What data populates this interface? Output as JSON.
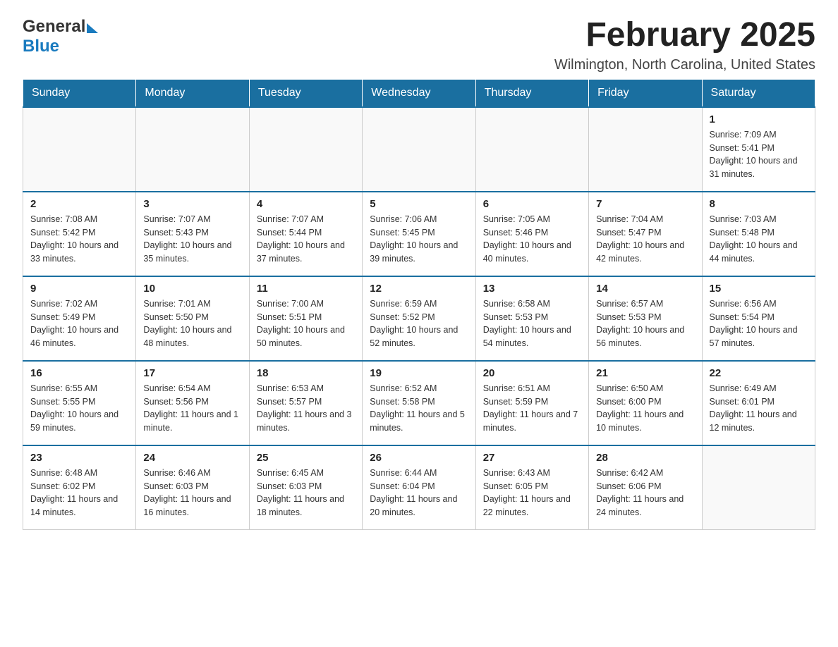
{
  "header": {
    "logo_general": "General",
    "logo_blue": "Blue",
    "month_title": "February 2025",
    "location": "Wilmington, North Carolina, United States"
  },
  "days_of_week": [
    "Sunday",
    "Monday",
    "Tuesday",
    "Wednesday",
    "Thursday",
    "Friday",
    "Saturday"
  ],
  "weeks": [
    [
      {
        "day": "",
        "info": ""
      },
      {
        "day": "",
        "info": ""
      },
      {
        "day": "",
        "info": ""
      },
      {
        "day": "",
        "info": ""
      },
      {
        "day": "",
        "info": ""
      },
      {
        "day": "",
        "info": ""
      },
      {
        "day": "1",
        "info": "Sunrise: 7:09 AM\nSunset: 5:41 PM\nDaylight: 10 hours and 31 minutes."
      }
    ],
    [
      {
        "day": "2",
        "info": "Sunrise: 7:08 AM\nSunset: 5:42 PM\nDaylight: 10 hours and 33 minutes."
      },
      {
        "day": "3",
        "info": "Sunrise: 7:07 AM\nSunset: 5:43 PM\nDaylight: 10 hours and 35 minutes."
      },
      {
        "day": "4",
        "info": "Sunrise: 7:07 AM\nSunset: 5:44 PM\nDaylight: 10 hours and 37 minutes."
      },
      {
        "day": "5",
        "info": "Sunrise: 7:06 AM\nSunset: 5:45 PM\nDaylight: 10 hours and 39 minutes."
      },
      {
        "day": "6",
        "info": "Sunrise: 7:05 AM\nSunset: 5:46 PM\nDaylight: 10 hours and 40 minutes."
      },
      {
        "day": "7",
        "info": "Sunrise: 7:04 AM\nSunset: 5:47 PM\nDaylight: 10 hours and 42 minutes."
      },
      {
        "day": "8",
        "info": "Sunrise: 7:03 AM\nSunset: 5:48 PM\nDaylight: 10 hours and 44 minutes."
      }
    ],
    [
      {
        "day": "9",
        "info": "Sunrise: 7:02 AM\nSunset: 5:49 PM\nDaylight: 10 hours and 46 minutes."
      },
      {
        "day": "10",
        "info": "Sunrise: 7:01 AM\nSunset: 5:50 PM\nDaylight: 10 hours and 48 minutes."
      },
      {
        "day": "11",
        "info": "Sunrise: 7:00 AM\nSunset: 5:51 PM\nDaylight: 10 hours and 50 minutes."
      },
      {
        "day": "12",
        "info": "Sunrise: 6:59 AM\nSunset: 5:52 PM\nDaylight: 10 hours and 52 minutes."
      },
      {
        "day": "13",
        "info": "Sunrise: 6:58 AM\nSunset: 5:53 PM\nDaylight: 10 hours and 54 minutes."
      },
      {
        "day": "14",
        "info": "Sunrise: 6:57 AM\nSunset: 5:53 PM\nDaylight: 10 hours and 56 minutes."
      },
      {
        "day": "15",
        "info": "Sunrise: 6:56 AM\nSunset: 5:54 PM\nDaylight: 10 hours and 57 minutes."
      }
    ],
    [
      {
        "day": "16",
        "info": "Sunrise: 6:55 AM\nSunset: 5:55 PM\nDaylight: 10 hours and 59 minutes."
      },
      {
        "day": "17",
        "info": "Sunrise: 6:54 AM\nSunset: 5:56 PM\nDaylight: 11 hours and 1 minute."
      },
      {
        "day": "18",
        "info": "Sunrise: 6:53 AM\nSunset: 5:57 PM\nDaylight: 11 hours and 3 minutes."
      },
      {
        "day": "19",
        "info": "Sunrise: 6:52 AM\nSunset: 5:58 PM\nDaylight: 11 hours and 5 minutes."
      },
      {
        "day": "20",
        "info": "Sunrise: 6:51 AM\nSunset: 5:59 PM\nDaylight: 11 hours and 7 minutes."
      },
      {
        "day": "21",
        "info": "Sunrise: 6:50 AM\nSunset: 6:00 PM\nDaylight: 11 hours and 10 minutes."
      },
      {
        "day": "22",
        "info": "Sunrise: 6:49 AM\nSunset: 6:01 PM\nDaylight: 11 hours and 12 minutes."
      }
    ],
    [
      {
        "day": "23",
        "info": "Sunrise: 6:48 AM\nSunset: 6:02 PM\nDaylight: 11 hours and 14 minutes."
      },
      {
        "day": "24",
        "info": "Sunrise: 6:46 AM\nSunset: 6:03 PM\nDaylight: 11 hours and 16 minutes."
      },
      {
        "day": "25",
        "info": "Sunrise: 6:45 AM\nSunset: 6:03 PM\nDaylight: 11 hours and 18 minutes."
      },
      {
        "day": "26",
        "info": "Sunrise: 6:44 AM\nSunset: 6:04 PM\nDaylight: 11 hours and 20 minutes."
      },
      {
        "day": "27",
        "info": "Sunrise: 6:43 AM\nSunset: 6:05 PM\nDaylight: 11 hours and 22 minutes."
      },
      {
        "day": "28",
        "info": "Sunrise: 6:42 AM\nSunset: 6:06 PM\nDaylight: 11 hours and 24 minutes."
      },
      {
        "day": "",
        "info": ""
      }
    ]
  ]
}
